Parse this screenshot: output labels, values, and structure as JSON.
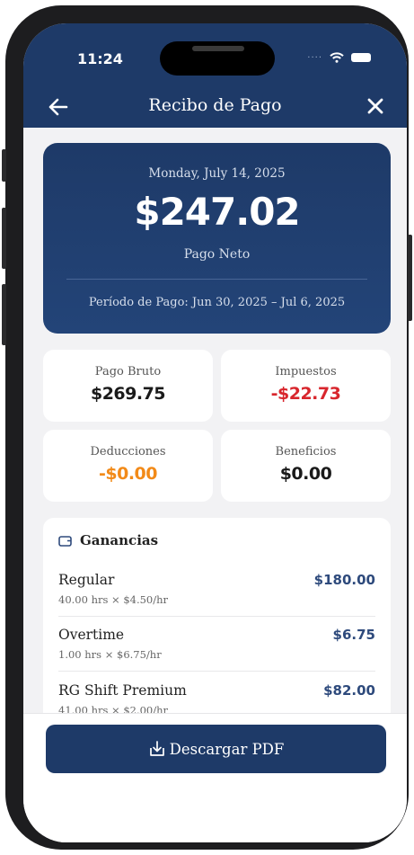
{
  "status_bar": {
    "time": "11:24"
  },
  "nav": {
    "title": "Recibo de Pago"
  },
  "summary": {
    "date": "Monday, July 14, 2025",
    "net_amount": "$247.02",
    "net_label": "Pago Neto",
    "period": "Período de Pago: Jun 30, 2025 – Jul 6, 2025"
  },
  "cards": [
    {
      "label": "Pago Bruto",
      "value": "$269.75",
      "color": "#1a1a1a"
    },
    {
      "label": "Impuestos",
      "value": "-$22.73",
      "color": "#d8262d"
    },
    {
      "label": "Deducciones",
      "value": "-$0.00",
      "color": "#f28a18"
    },
    {
      "label": "Beneficios",
      "value": "$0.00",
      "color": "#1a1a1a"
    }
  ],
  "earnings": {
    "title": "Ganancias",
    "icon": "wallet-icon",
    "items": [
      {
        "name": "Regular",
        "detail": "40.00 hrs × $4.50/hr",
        "amount": "$180.00"
      },
      {
        "name": "Overtime",
        "detail": "1.00 hrs × $6.75/hr",
        "amount": "$6.75"
      },
      {
        "name": "RG Shift Premium",
        "detail": "41.00 hrs × $2.00/hr",
        "amount": "$82.00"
      }
    ]
  },
  "actions": {
    "download_label": "Descargar PDF",
    "download_icon": "download-icon"
  },
  "colors": {
    "primary": "#1e3a68",
    "accent_amount": "#2e4a7c",
    "negative": "#d8262d",
    "warning": "#f28a18"
  }
}
